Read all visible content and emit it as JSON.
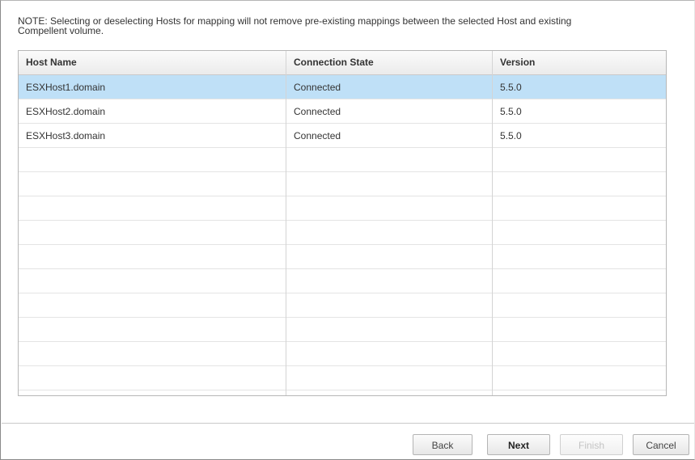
{
  "note": "NOTE: Selecting or deselecting Hosts for mapping will not remove pre-existing mappings between the selected Host and existing Compellent volume.",
  "table": {
    "columns": [
      "Host Name",
      "Connection State",
      "Version"
    ],
    "rows": [
      {
        "host": "ESXHost1.domain",
        "state": "Connected",
        "version": "5.5.0",
        "selected": true
      },
      {
        "host": "ESXHost2.domain",
        "state": "Connected",
        "version": "5.5.0",
        "selected": false
      },
      {
        "host": "ESXHost3.domain",
        "state": "Connected",
        "version": "5.5.0",
        "selected": false
      }
    ],
    "empty_row_count": 10
  },
  "buttons": {
    "back": "Back",
    "next": "Next",
    "finish": "Finish",
    "cancel": "Cancel"
  },
  "colors": {
    "selected_row": "#bfe0f7",
    "disabled_text": "#c4c4c4"
  }
}
